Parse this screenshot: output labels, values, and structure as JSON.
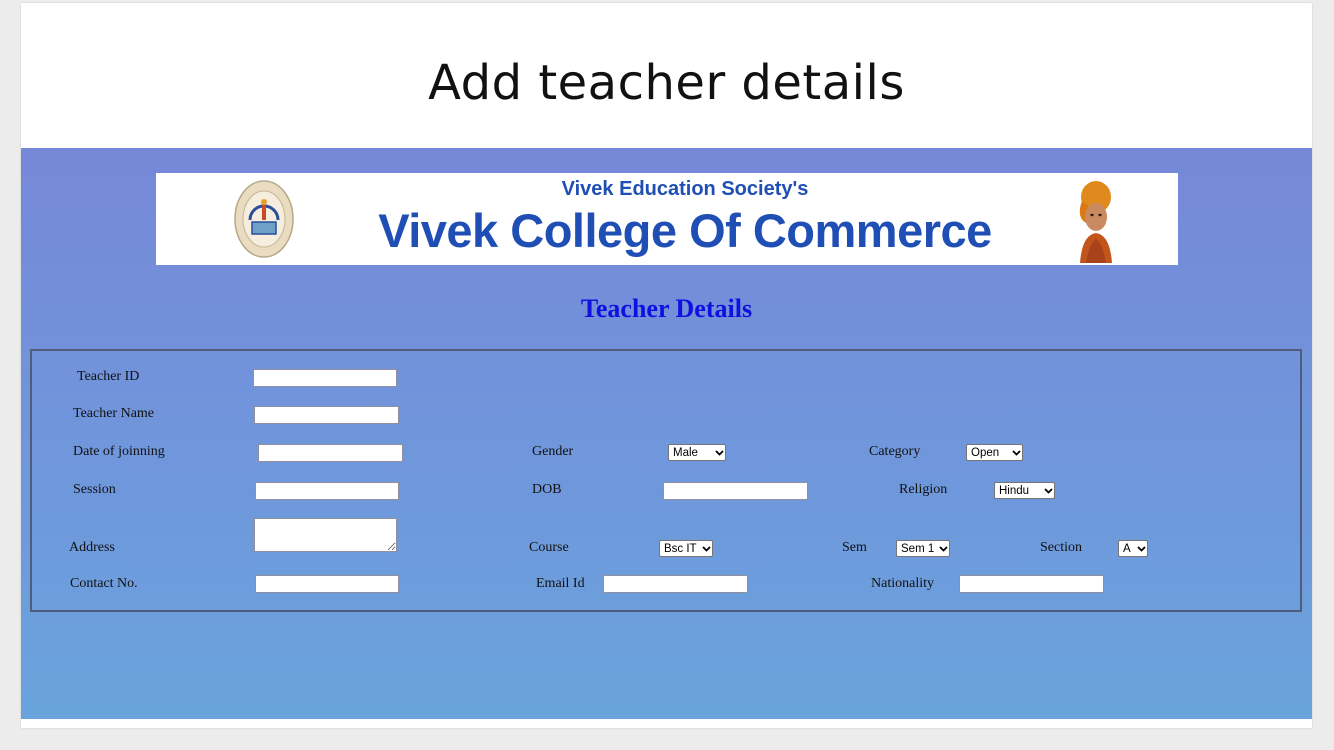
{
  "slide": {
    "title": "Add teacher details"
  },
  "banner": {
    "subtitle": "Vivek Education Society's",
    "college_name": "Vivek College Of Commerce"
  },
  "form": {
    "heading": "Teacher Details",
    "fields": {
      "teacher_id": {
        "label": "Teacher ID",
        "value": ""
      },
      "teacher_name": {
        "label": "Teacher Name",
        "value": ""
      },
      "date_of_joining": {
        "label": "Date of joinning",
        "value": ""
      },
      "session": {
        "label": "Session",
        "value": ""
      },
      "address": {
        "label": "Address",
        "value": ""
      },
      "contact_no": {
        "label": "Contact No.",
        "value": ""
      },
      "gender": {
        "label": "Gender",
        "selected": "Male"
      },
      "dob": {
        "label": "DOB",
        "value": ""
      },
      "course": {
        "label": "Course",
        "selected": "Bsc IT"
      },
      "email_id": {
        "label": "Email Id",
        "value": ""
      },
      "category": {
        "label": "Category",
        "selected": "Open"
      },
      "religion": {
        "label": "Religion",
        "selected": "Hindu"
      },
      "sem": {
        "label": "Sem",
        "selected": "Sem 1"
      },
      "section": {
        "label": "Section",
        "selected": "A"
      },
      "nationality": {
        "label": "Nationality",
        "value": ""
      }
    }
  },
  "colors": {
    "banner_text": "#1f4fb5",
    "form_heading": "#1010e0",
    "gradient_top": "#7688d8",
    "gradient_bottom": "#6aa4dc"
  },
  "icons": {
    "logo": "society-emblem-icon",
    "portrait": "swami-vivekananda-portrait",
    "dropdown": "chevron-down-icon"
  }
}
